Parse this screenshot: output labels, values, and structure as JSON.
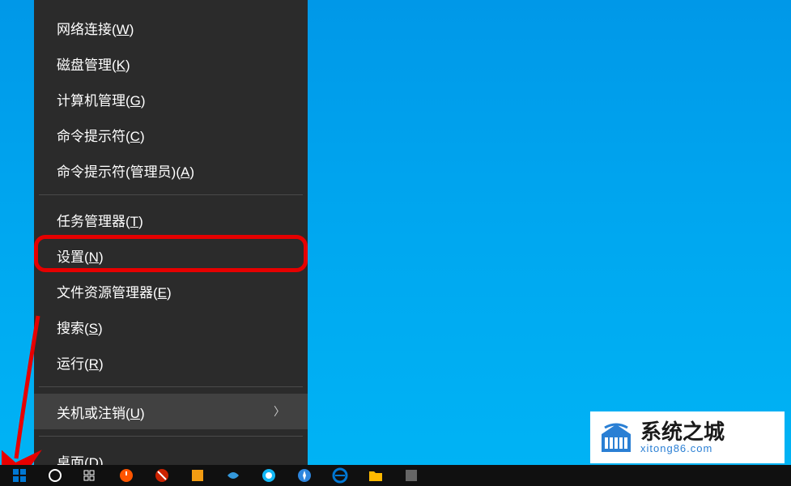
{
  "menu": {
    "highlighted_index": 5,
    "hovered_index": 10,
    "groups": [
      {
        "items": [
          {
            "id": "network-connections",
            "label": "网络连接(<u>W</u>)",
            "submenu": false
          },
          {
            "id": "disk-management",
            "label": "磁盘管理(<u>K</u>)",
            "submenu": false
          },
          {
            "id": "computer-management",
            "label": "计算机管理(<u>G</u>)",
            "submenu": false
          },
          {
            "id": "command-prompt",
            "label": "命令提示符(<u>C</u>)",
            "submenu": false
          },
          {
            "id": "command-prompt-admin",
            "label": "命令提示符(管理员)(<u>A</u>)",
            "submenu": false
          }
        ]
      },
      {
        "items": [
          {
            "id": "task-manager",
            "label": "任务管理器(<u>T</u>)",
            "submenu": false
          },
          {
            "id": "settings",
            "label": "设置(<u>N</u>)",
            "submenu": false
          },
          {
            "id": "file-explorer",
            "label": "文件资源管理器(<u>E</u>)",
            "submenu": false
          },
          {
            "id": "search",
            "label": "搜索(<u>S</u>)",
            "submenu": false
          },
          {
            "id": "run",
            "label": "运行(<u>R</u>)",
            "submenu": false
          }
        ]
      },
      {
        "items": [
          {
            "id": "shutdown-signout",
            "label": "关机或注销(<u>U</u>)",
            "submenu": true
          }
        ]
      },
      {
        "items": [
          {
            "id": "desktop",
            "label": "桌面(<u>D</u>)",
            "submenu": false
          }
        ]
      }
    ]
  },
  "taskbar": {
    "icons": [
      {
        "id": "start",
        "name": "start-icon",
        "color": "#0078d4"
      },
      {
        "id": "cortana",
        "name": "circle-icon",
        "color": "#ffffff"
      },
      {
        "id": "taskview",
        "name": "taskview-icon",
        "color": "#ffffff"
      },
      {
        "id": "app1",
        "name": "power-icon",
        "color": "#ff5500"
      },
      {
        "id": "app2",
        "name": "block-icon",
        "color": "#cc2200"
      },
      {
        "id": "app3",
        "name": "app-icon",
        "color": "#f39c12"
      },
      {
        "id": "app4",
        "name": "leaf-icon",
        "color": "#3498db"
      },
      {
        "id": "app5",
        "name": "qq-icon",
        "color": "#12b7f5"
      },
      {
        "id": "app6",
        "name": "compass-icon",
        "color": "#2e86de"
      },
      {
        "id": "edge",
        "name": "edge-icon",
        "color": "#0078d4"
      },
      {
        "id": "explorer",
        "name": "folder-icon",
        "color": "#ffb900"
      },
      {
        "id": "app7",
        "name": "app-icon",
        "color": "#666666"
      }
    ]
  },
  "watermark": {
    "title": "系统之城",
    "url": "xitong86.com"
  }
}
